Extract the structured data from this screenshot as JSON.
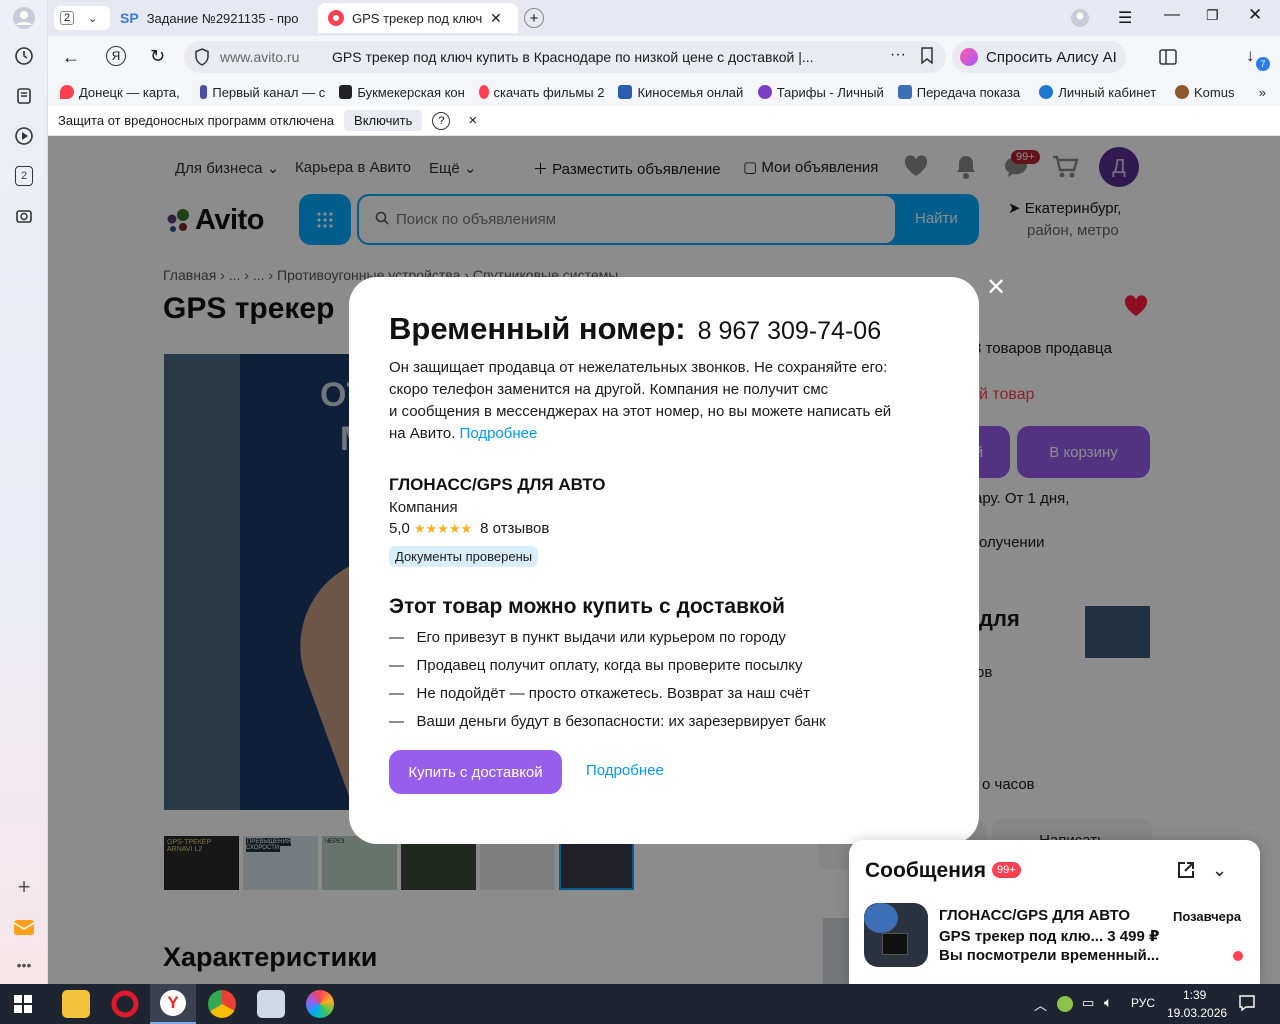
{
  "browser": {
    "tab_count_badge": "2",
    "tabs": [
      {
        "label": "Задание №2921135 - про",
        "icon": "sp-icon"
      },
      {
        "label": "GPS трекер под ключ к",
        "icon": "avito-icon",
        "active": true
      }
    ],
    "address_host": "www.avito.ru",
    "address_title": "GPS трекер под ключ купить в Краснодаре по низкой цене с доставкой |...",
    "alice_label": "Спросить Алису AI",
    "downloads_badge": "7",
    "bookmarks": [
      "Донецк — карта, ",
      "Первый канал — с",
      "Букмекерская кон",
      "скачать фильмы 2",
      "Киносемья онлай",
      "Тарифы - Личный",
      "Передача показа",
      "Личный кабинет",
      "Komus"
    ],
    "infobar": {
      "text": "Защита от вредоносных программ отключена",
      "button": "Включить",
      "help": "?",
      "close": "×"
    },
    "rail_badge": "2"
  },
  "avito": {
    "topnav": [
      "Для бизнеса",
      "Карьера в Авито",
      "Ещё"
    ],
    "post_ad": "Разместить объявление",
    "my_ads": "Мои объявления",
    "messages_badge": "99+",
    "avatar_letter": "Д",
    "logo": "Avito",
    "search_placeholder": "Поиск по объявлениям",
    "search_button": "Найти",
    "location_city": "Екатеринбург,",
    "location_sub": "район, метро",
    "breadcrumb": [
      "Главная",
      "...",
      "...",
      "Противоугонные устройства",
      "Спутниковые системы"
    ],
    "title_fragment": "GPS трекер",
    "side_texts": [
      "3 товаров продавца",
      "й товар",
      "й",
      "В корзину",
      "ару. От 1 дня,",
      "олучении",
      "для",
      "ов",
      "о часов",
      "Написать"
    ],
    "thumb_labels": [
      "GPS-ТРЕКЕР ARNAVI L2",
      "ПРЕВЫШЕНИЯ СКОРОСТИ",
      "ЧЕРЕЗ"
    ],
    "characteristics": "Характеристики"
  },
  "modal": {
    "heading": "Временный номер:",
    "phone": "8 967 309-74-06",
    "description": "Он защищает продавца от нежелательных звонков. Не сохраняйте его: скоро телефон заменится на другой. Компания не получит смс и сообщения в мессенджерах на этот номер, но вы можете написать ей на Авито.",
    "desc_lines": [
      "Он защищает продавца от нежелательных звонков. Не сохраняйте его:",
      "скоро телефон заменится на другой. Компания не получит смс",
      "и сообщения в мессенджерах на этот номер, но вы можете написать ей",
      "на Авито."
    ],
    "more_link": "Подробнее",
    "seller_name": "ГЛОНАСС/GPS ДЛЯ АВТО",
    "seller_type": "Компания",
    "rating": "5,0",
    "stars": 5,
    "reviews": "8 отзывов",
    "docs_badge": "Документы проверены",
    "delivery_heading": "Этот товар можно купить с доставкой",
    "delivery_points": [
      "Его привезут в пункт выдачи или курьером по городу",
      "Продавец получит оплату, когда вы проверите посылку",
      "Не подойдёт — просто откажетесь. Возврат за наш счёт",
      "Ваши деньги будут в безопасности: их зарезервирует банк"
    ],
    "buy_button": "Купить с доставкой",
    "more_button": "Подробнее"
  },
  "messenger": {
    "title": "Сообщения",
    "badge": "99+",
    "seller": "ГЛОНАСС/GPS ДЛЯ АВТО",
    "item": "GPS трекер под клю...",
    "price": "3 499 ₽",
    "preview": "Вы посмотрели временный...",
    "date": "Позавчера"
  },
  "taskbar": {
    "lang": "РУС",
    "time": "1:39",
    "date": "19.03.2026"
  },
  "colors": {
    "avito_blue": "#00aaff",
    "avito_purple": "#965eeb",
    "link": "#0099f7",
    "red_badge": "#ff4053"
  }
}
